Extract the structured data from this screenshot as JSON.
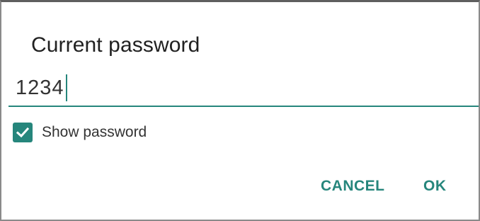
{
  "dialog": {
    "title": "Current password",
    "password_value": "1234",
    "show_password_label": "Show password",
    "show_password_checked": true,
    "cancel_label": "CANCEL",
    "ok_label": "OK"
  },
  "colors": {
    "accent": "#26867c",
    "text": "#212121",
    "border": "#8a8a8a"
  },
  "icons": {
    "checkbox": "checkmark-icon"
  }
}
